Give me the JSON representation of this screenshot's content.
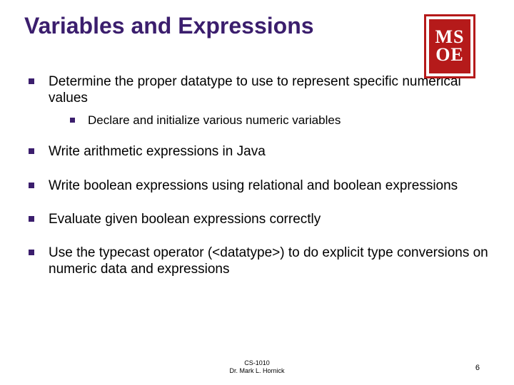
{
  "title": "Variables and Expressions",
  "logo": {
    "line1": "MS",
    "line2": "OE"
  },
  "bullets": [
    {
      "text": "Determine the proper datatype to use to represent specific numerical values",
      "sub": [
        {
          "text": "Declare and initialize various numeric variables"
        }
      ]
    },
    {
      "text": "Write arithmetic expressions in Java"
    },
    {
      "text": "Write boolean expressions using relational and boolean expressions"
    },
    {
      "text": "Evaluate given boolean expressions correctly"
    },
    {
      "text": "Use the typecast operator (<datatype>) to do explicit type conversions on numeric data and expressions"
    }
  ],
  "footer": {
    "course": "CS-1010",
    "author": "Dr. Mark L. Hornick"
  },
  "page": "6"
}
